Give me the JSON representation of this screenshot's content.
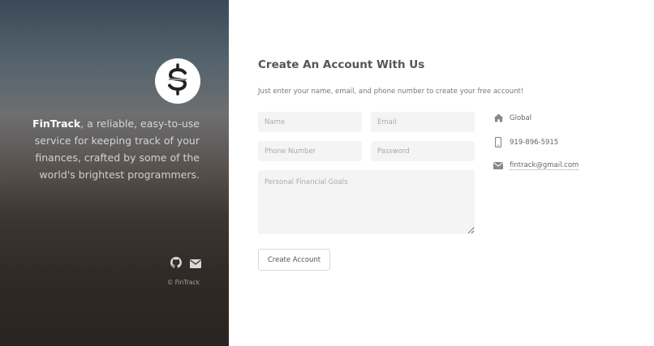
{
  "brand": {
    "name": "FinTrack",
    "tagline_rest": ", a reliable, easy-to-use service for keeping track of your finances, crafted by some of the world's brightest programmers.",
    "logo_icon": "dollar-sign-icon",
    "copyright": "© FinTrack"
  },
  "social": [
    {
      "icon": "github-icon"
    },
    {
      "icon": "envelope-icon"
    }
  ],
  "form": {
    "title": "Create An Account With Us",
    "subtitle": "Just enter your name, email, and phone number to create your free account!",
    "name_placeholder": "Name",
    "email_placeholder": "Email",
    "phone_placeholder": "Phone Number",
    "password_placeholder": "Password",
    "goals_placeholder": "Personal Financial Goals",
    "submit_label": "Create Account"
  },
  "contact": {
    "location": "Global",
    "phone": "919-896-5915",
    "email": "fintrack@gmail.com"
  },
  "colors": {
    "panel_top": "#3b4a57",
    "panel_bottom": "#2a2421",
    "field_bg": "#f4f4f4",
    "icon_gray": "#888888"
  }
}
